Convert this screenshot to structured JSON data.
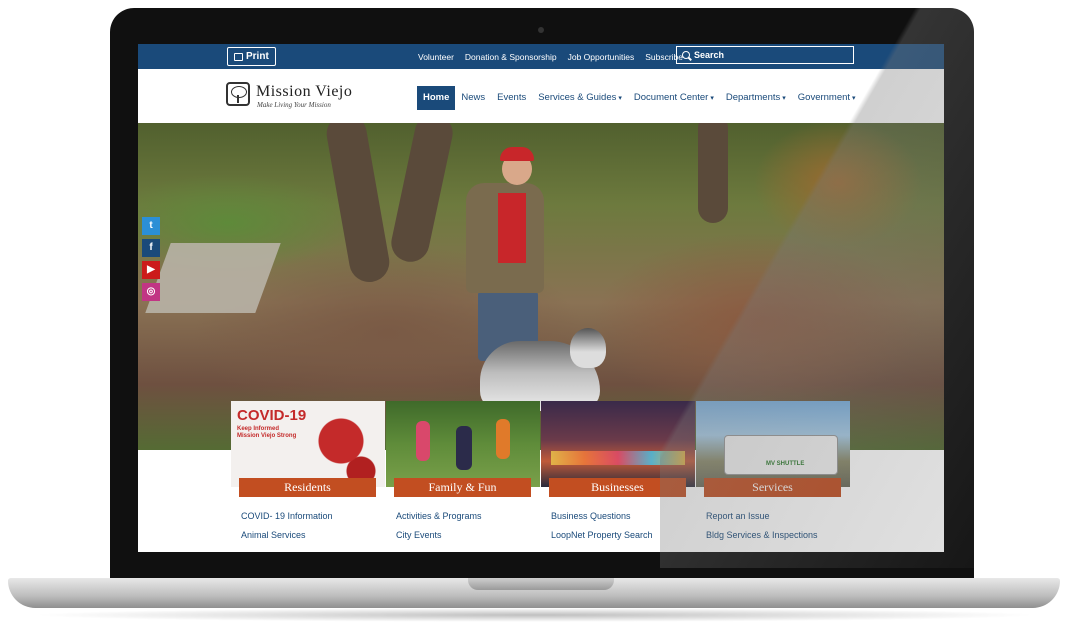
{
  "topbar": {
    "print_label": "Print",
    "links": [
      "Volunteer",
      "Donation & Sponsorship",
      "Job Opportunities",
      "Subscribe"
    ],
    "search_placeholder": "Search"
  },
  "logo": {
    "title": "Mission Viejo",
    "tagline": "Make Living Your Mission"
  },
  "nav": {
    "items": [
      {
        "label": "Home",
        "active": true
      },
      {
        "label": "News"
      },
      {
        "label": "Events"
      },
      {
        "label": "Services & Guides"
      },
      {
        "label": "Document Center"
      },
      {
        "label": "Departments"
      },
      {
        "label": "Government"
      }
    ]
  },
  "social": [
    {
      "icon": "twitter-icon",
      "glyph": "t",
      "color": "#2b8fd6"
    },
    {
      "icon": "facebook-icon",
      "glyph": "f",
      "color": "#1a4a7a"
    },
    {
      "icon": "youtube-icon",
      "glyph": "▶",
      "color": "#cc1b1b"
    },
    {
      "icon": "instagram-icon",
      "glyph": "◎",
      "color": "#c13584"
    }
  ],
  "cards": [
    {
      "title": "Residents",
      "image_text": "COVID-19",
      "image_subtext": "Keep Informed Mission Viejo Strong",
      "links": [
        "COVID- 19 Information",
        "Animal Services"
      ]
    },
    {
      "title": "Family & Fun",
      "links": [
        "Activities & Programs",
        "City Events"
      ]
    },
    {
      "title": "Businesses",
      "links": [
        "Business Questions",
        "LoopNet Property Search"
      ]
    },
    {
      "title": "Services",
      "image_text": "MV SHUTTLE",
      "links": [
        "Report an Issue",
        "Bldg Services & Inspections"
      ]
    }
  ],
  "colors": {
    "brand_blue": "#1a4a7a",
    "accent_orange": "#c24e21"
  }
}
